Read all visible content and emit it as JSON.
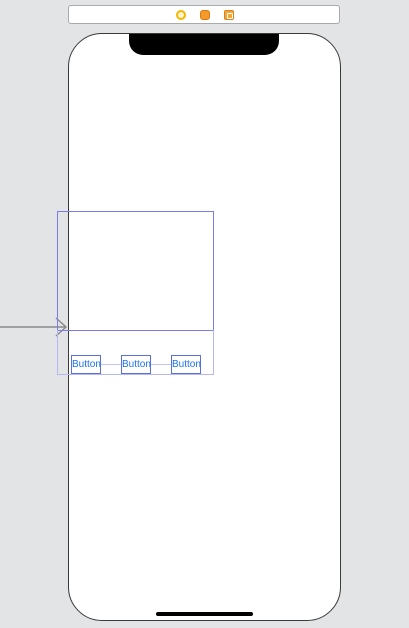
{
  "scene_dock": {
    "icons": [
      "view-controller-icon",
      "first-responder-icon",
      "exit-icon"
    ],
    "colors": {
      "view_controller": "#f5b800",
      "first_responder": "#f39a2b",
      "exit": "#f5a83a"
    }
  },
  "device": {
    "background": "#ffffff",
    "notch_color": "#000000"
  },
  "buttons": [
    {
      "label": "Button"
    },
    {
      "label": "Button"
    },
    {
      "label": "Button"
    }
  ],
  "colors": {
    "canvas": "#e3e4e6",
    "selection_outline": "#7c7cf0",
    "button_text": "#1a73e8"
  }
}
